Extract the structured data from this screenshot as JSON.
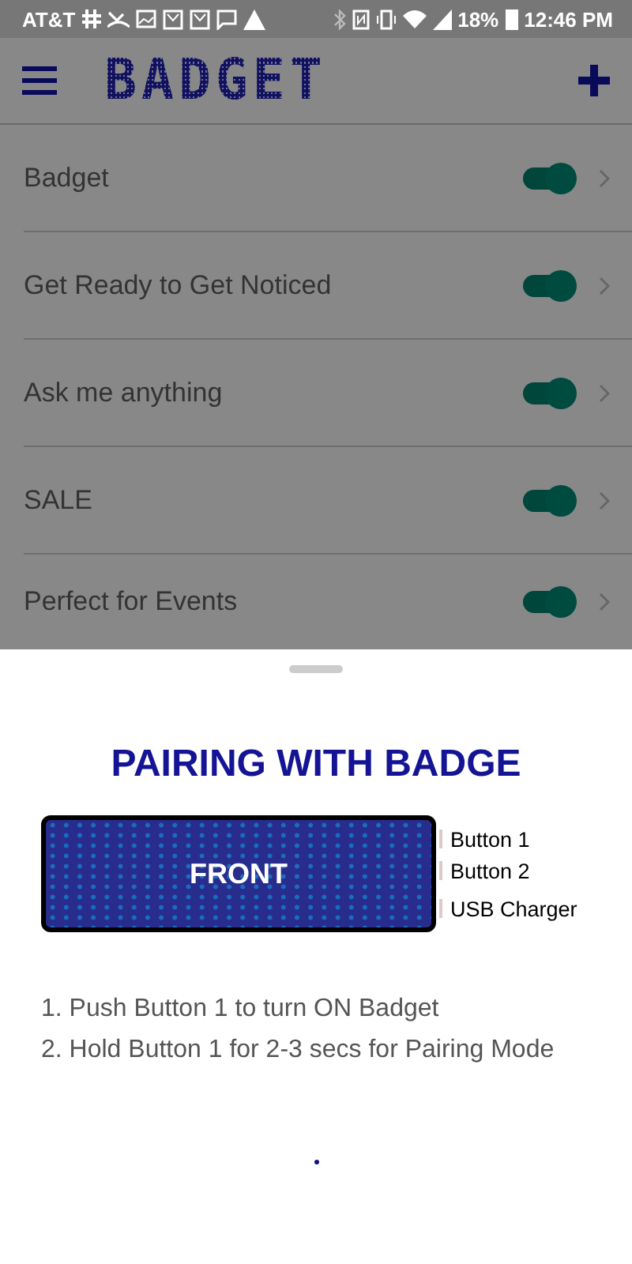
{
  "status_bar": {
    "carrier": "AT&T",
    "battery": "18%",
    "time": "12:46 PM"
  },
  "app_bar": {
    "logo": "BADGET"
  },
  "messages": [
    {
      "label": "Badget",
      "on": true
    },
    {
      "label": "Get Ready to Get Noticed",
      "on": true
    },
    {
      "label": "Ask me anything",
      "on": true
    },
    {
      "label": "SALE",
      "on": true
    },
    {
      "label": "Perfect for Events",
      "on": true
    }
  ],
  "sheet": {
    "title": "PAIRING WITH BADGE",
    "badge_label": "FRONT",
    "side_labels": [
      "Button 1",
      "Button 2",
      "USB Charger"
    ],
    "steps": [
      "1. Push Button 1 to turn ON Badget",
      "2. Hold Button 1 for 2-3 secs for Pairing Mode"
    ]
  }
}
